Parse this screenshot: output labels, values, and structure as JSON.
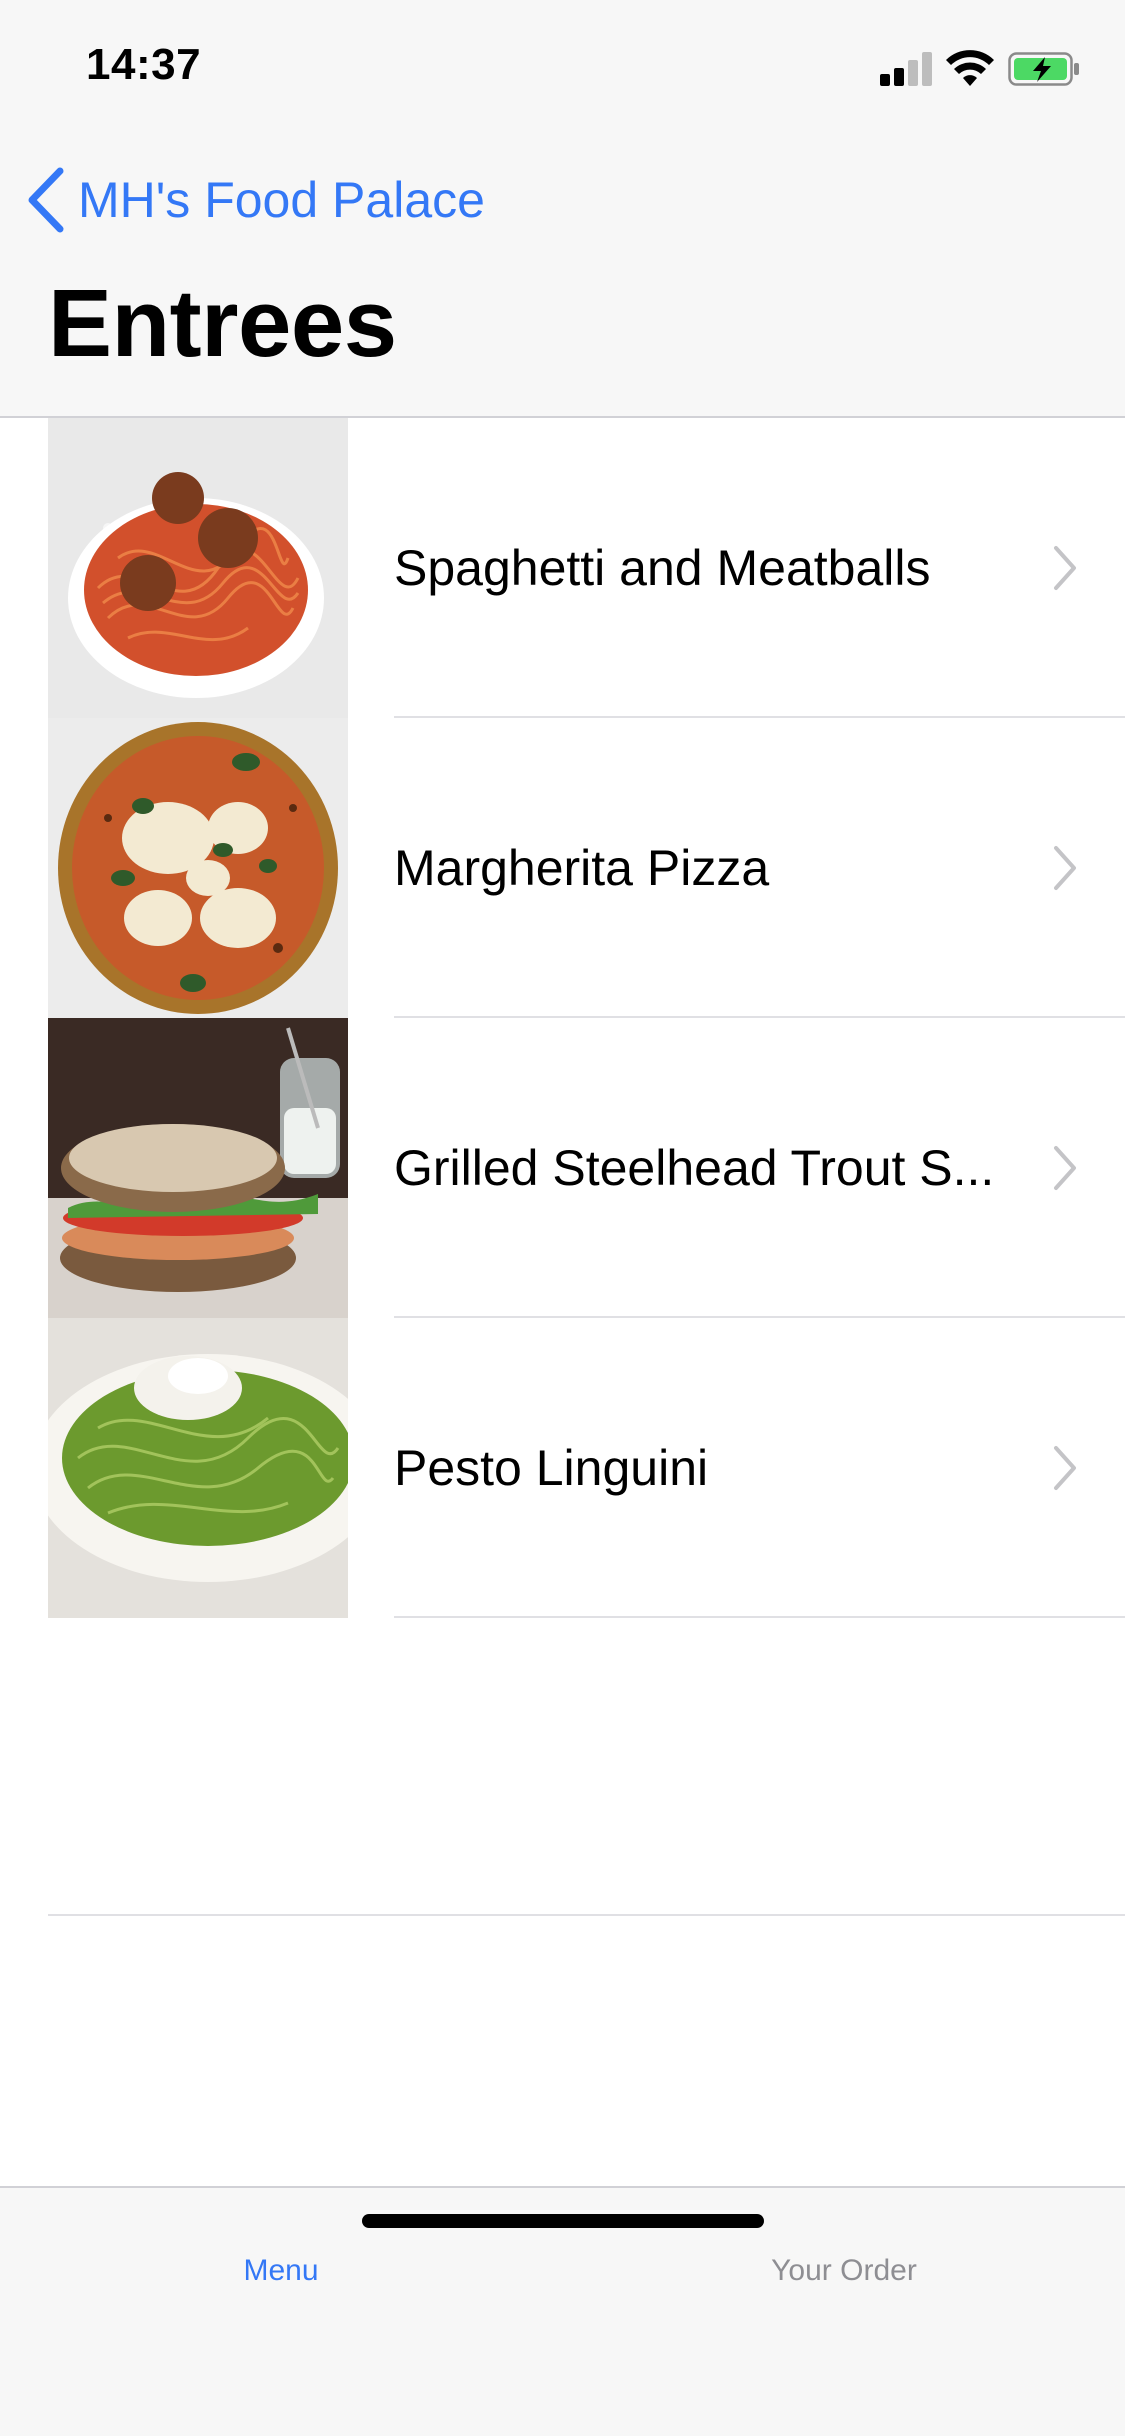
{
  "status_bar": {
    "time": "14:37",
    "icons": [
      "cellular-signal-icon",
      "wifi-icon",
      "battery-charging-icon"
    ]
  },
  "nav": {
    "back_label": "MH's Food Palace",
    "title": "Entrees"
  },
  "menu_items": [
    {
      "name": "Spaghetti and Meatballs",
      "image": "spaghetti-meatballs-photo"
    },
    {
      "name": "Margherita Pizza",
      "image": "margherita-pizza-photo"
    },
    {
      "name": "Grilled Steelhead Trout S...",
      "image": "steelhead-trout-sandwich-photo"
    },
    {
      "name": "Pesto Linguini",
      "image": "pesto-linguini-photo"
    }
  ],
  "tab_bar": {
    "tabs": [
      {
        "label": "Menu",
        "selected": true
      },
      {
        "label": "Your Order",
        "selected": false
      }
    ]
  },
  "colors": {
    "accent": "#3478f6",
    "tab_inactive": "#8e8e93",
    "battery_fill": "#4cd964",
    "chevron": "#c4c4c7"
  }
}
